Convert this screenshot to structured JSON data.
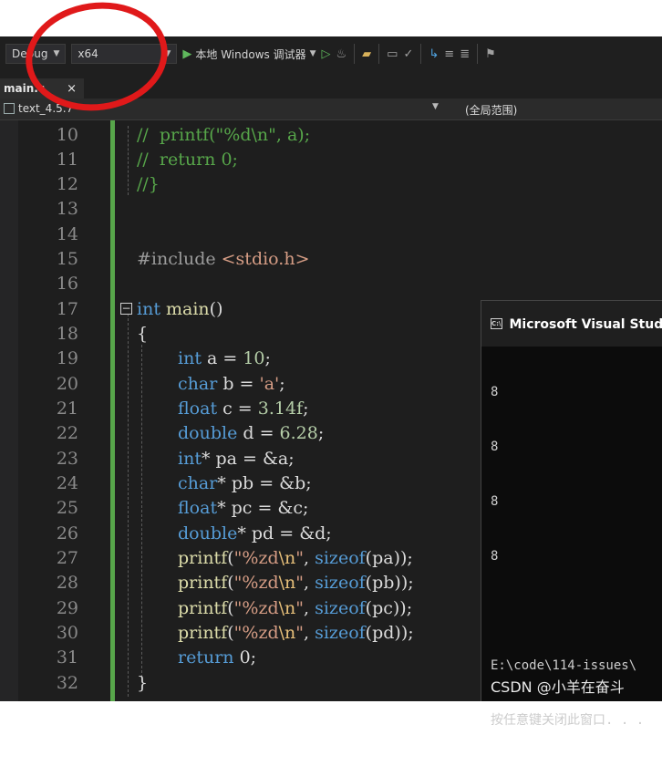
{
  "toolbar": {
    "config": "Debug",
    "platform": "x64",
    "run_label": "本地 Windows 调试器",
    "icons": [
      "play-icon",
      "start-without-debug-icon",
      "hot-reload-icon",
      "folder-icon",
      "window-icon",
      "spellcheck-icon",
      "step-icon",
      "comment-icon",
      "bookmark-icon"
    ]
  },
  "tabs": [
    {
      "label": "main.c",
      "close": "×"
    }
  ],
  "nav": {
    "project": "text_4.5.7",
    "scope": "(全局范围)"
  },
  "editor": {
    "lines": [
      {
        "num": "10"
      },
      {
        "num": "11"
      },
      {
        "num": "12"
      },
      {
        "num": "13"
      },
      {
        "num": "14"
      },
      {
        "num": "15"
      },
      {
        "num": "16"
      },
      {
        "num": "17"
      },
      {
        "num": "18"
      },
      {
        "num": "19"
      },
      {
        "num": "20"
      },
      {
        "num": "21"
      },
      {
        "num": "22"
      },
      {
        "num": "23"
      },
      {
        "num": "24"
      },
      {
        "num": "25"
      },
      {
        "num": "26"
      },
      {
        "num": "27"
      },
      {
        "num": "28"
      },
      {
        "num": "29"
      },
      {
        "num": "30"
      },
      {
        "num": "31"
      },
      {
        "num": "32"
      }
    ],
    "code": {
      "l10a": "//  printf(",
      "l10b": "\"%d\\n\"",
      "l10c": ", a);",
      "l11a": "//  return 0;",
      "l12a": "//}",
      "l15a": "#include ",
      "l15b": "<stdio.h>",
      "l17a": "int",
      "l17b": " main",
      "l17c": "()",
      "l18a": "{",
      "l19a": "int",
      "l19b": " a = ",
      "l19c": "10",
      "l19d": ";",
      "l20a": "char",
      "l20b": " b = ",
      "l20c": "'a'",
      "l20d": ";",
      "l21a": "float",
      "l21b": " c = ",
      "l21c": "3.14f",
      "l21d": ";",
      "l22a": "double",
      "l22b": " d = ",
      "l22c": "6.28",
      "l22d": ";",
      "l23a": "int",
      "l23b": "* pa = &a;",
      "l24a": "char",
      "l24b": "* pb = &b;",
      "l25a": "float",
      "l25b": "* pc = &c;",
      "l26a": "double",
      "l26b": "* pd = &d;",
      "l27a": "printf",
      "l27b": "(",
      "l27c": "\"%zd",
      "l27d": "\\n",
      "l27e": "\"",
      "l27f": ", ",
      "l27g": "sizeof",
      "l27h": "(pa));",
      "l28a": "printf",
      "l28b": "(",
      "l28c": "\"%zd",
      "l28d": "\\n",
      "l28e": "\"",
      "l28f": ", ",
      "l28g": "sizeof",
      "l28h": "(pb));",
      "l29a": "printf",
      "l29b": "(",
      "l29c": "\"%zd",
      "l29d": "\\n",
      "l29e": "\"",
      "l29f": ", ",
      "l29g": "sizeof",
      "l29h": "(pc));",
      "l30a": "printf",
      "l30b": "(",
      "l30c": "\"%zd",
      "l30d": "\\n",
      "l30e": "\"",
      "l30f": ", ",
      "l30g": "sizeof",
      "l30h": "(pd));",
      "l31a": "return",
      "l31b": " 0;",
      "l32a": "}"
    },
    "fold_symbol": "−"
  },
  "console": {
    "title": "Microsoft Visual Studio 调试控制台",
    "icon_text": "C:\\",
    "output": [
      "8",
      "8",
      "8",
      "8",
      "",
      "E:\\code\\114-issues\\",
      "按任意键关闭此窗口. . ."
    ]
  },
  "watermark": "CSDN @小羊在奋斗",
  "colors": {
    "keyword": "#569cd6",
    "comment": "#57a64a",
    "string": "#d69d85",
    "annotation": "#e0191a"
  }
}
